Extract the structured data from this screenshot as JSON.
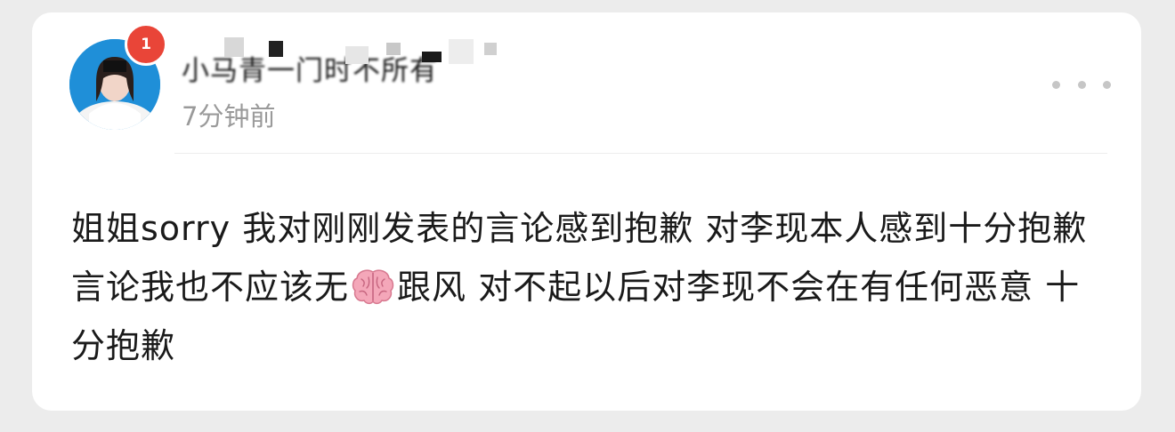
{
  "post": {
    "username": "小马青一门时不所有",
    "badge_count": "1",
    "timestamp": "7分钟前",
    "text_part1": "姐姐sorry 我对刚刚发表的言论感到抱歉 对李现本人感到十分抱歉 言论我也不应该无",
    "emoji": "brain-emoji",
    "text_part2": "跟风 对不起以后对李现不会在有任何恶意 十分抱歉"
  },
  "icons": {
    "more": "more-dots-icon"
  },
  "colors": {
    "badge": "#e94538",
    "avatar_bg": "#1f8fd8",
    "timestamp": "#9a9a9a",
    "text": "#1a1a1a",
    "card": "#ffffff",
    "page_bg": "#ececec"
  }
}
